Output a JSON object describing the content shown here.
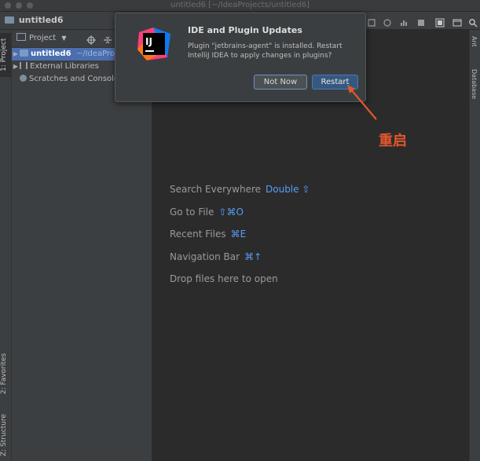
{
  "window": {
    "title": "untitled6 [~/IdeaProjects/untitled6]"
  },
  "navbar": {
    "project_name": "untitled6"
  },
  "left_stripe": {
    "tabs": [
      "1: Project",
      "2: Favorites",
      "Z: Structure"
    ]
  },
  "right_stripe": {
    "tabs": [
      "Ant",
      "Database"
    ]
  },
  "project_panel": {
    "dropdown_label": "Project",
    "tree": [
      {
        "name": "untitled6",
        "path": "~/IdeaProj"
      },
      {
        "name": "External Libraries"
      },
      {
        "name": "Scratches and Consoles"
      }
    ]
  },
  "editor_hints": [
    {
      "label": "Search Everywhere",
      "keys": "Double ⇧"
    },
    {
      "label": "Go to File",
      "keys": "⇧⌘O"
    },
    {
      "label": "Recent Files",
      "keys": "⌘E"
    },
    {
      "label": "Navigation Bar",
      "keys": "⌘↑"
    },
    {
      "label": "Drop files here to open",
      "keys": ""
    }
  ],
  "notification": {
    "logo_text": "IJ",
    "title": "IDE and Plugin Updates",
    "body": "Plugin \"jetbrains-agent\" is installed. Restart IntelliJ IDEA to apply changes in plugins?",
    "not_now_label": "Not Now",
    "restart_label": "Restart"
  },
  "annotation": {
    "text": "重启",
    "color": "#e2572d"
  }
}
